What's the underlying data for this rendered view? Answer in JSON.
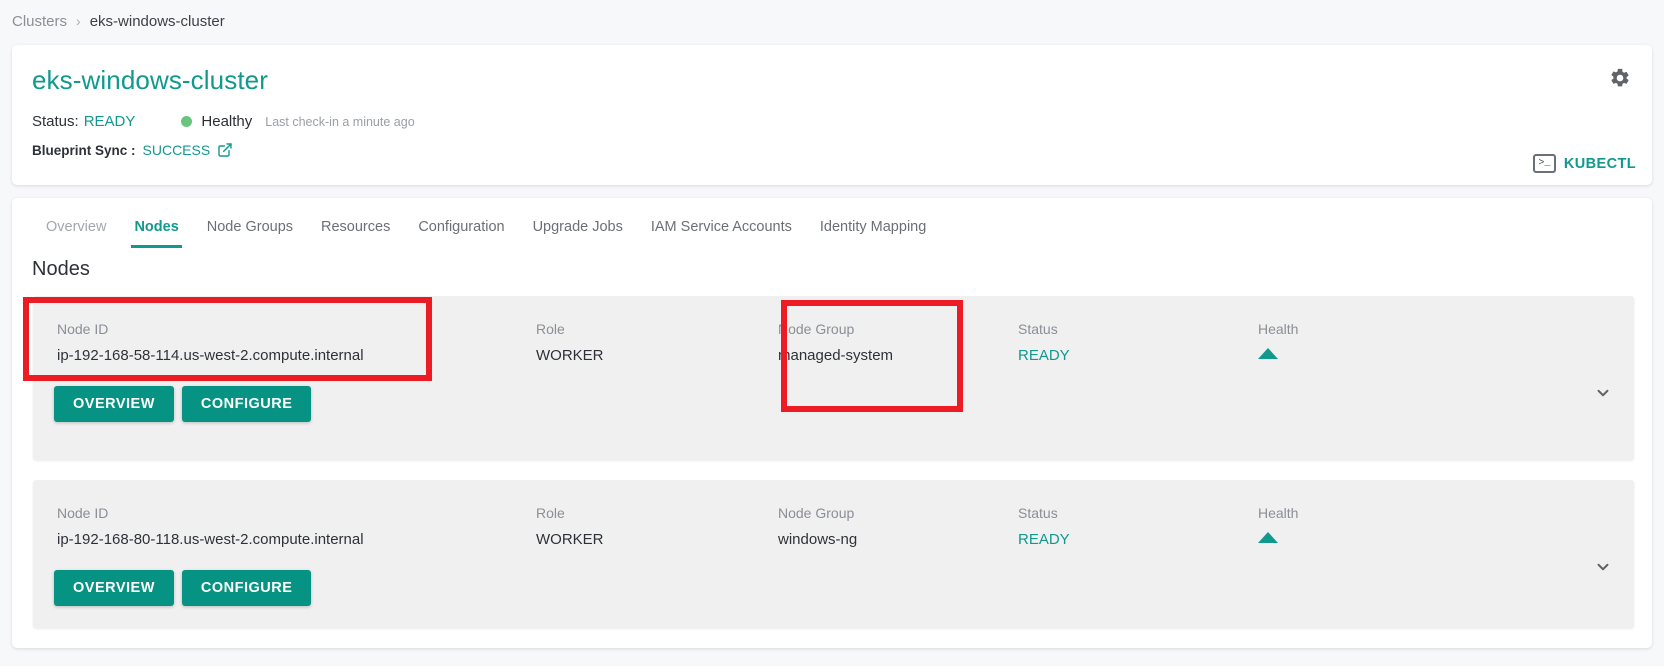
{
  "breadcrumb": {
    "parent": "Clusters",
    "separator": "›",
    "current": "eks-windows-cluster"
  },
  "summary": {
    "title": "eks-windows-cluster",
    "status_label": "Status:",
    "status_value": "READY",
    "health_text": "Healthy",
    "health_dot_color": "#6ac47e",
    "checkin_text": "Last check-in a minute ago",
    "blueprint_label": "Blueprint Sync :",
    "blueprint_value": "SUCCESS",
    "external_link_icon": "external-link-icon",
    "gear_icon": "gear-icon",
    "kubectl_label": "KUBECTL",
    "kubectl_icon": "terminal-icon",
    "terminal_glyph": ">_"
  },
  "tabs": [
    {
      "label": "Overview",
      "active": false
    },
    {
      "label": "Nodes",
      "active": true
    },
    {
      "label": "Node Groups",
      "active": false
    },
    {
      "label": "Resources",
      "active": false
    },
    {
      "label": "Configuration",
      "active": false
    },
    {
      "label": "Upgrade Jobs",
      "active": false
    },
    {
      "label": "IAM Service Accounts",
      "active": false
    },
    {
      "label": "Identity Mapping",
      "active": false
    }
  ],
  "section": {
    "title": "Nodes"
  },
  "columns": {
    "node_id": "Node ID",
    "role": "Role",
    "node_group": "Node Group",
    "status": "Status",
    "health": "Health"
  },
  "nodes": [
    {
      "node_id": "ip-192-168-58-114.us-west-2.compute.internal",
      "role": "WORKER",
      "node_group": "managed-system",
      "status": "READY",
      "health_icon": "triangle-up-icon",
      "expand_icon": "chevron-down-icon",
      "overview_label": "OVERVIEW",
      "configure_label": "CONFIGURE"
    },
    {
      "node_id": "ip-192-168-80-118.us-west-2.compute.internal",
      "role": "WORKER",
      "node_group": "windows-ng",
      "status": "READY",
      "health_icon": "triangle-up-icon",
      "expand_icon": "chevron-down-icon",
      "overview_label": "OVERVIEW",
      "configure_label": "CONFIGURE"
    }
  ],
  "annotations": [
    {
      "name": "node-id-highlight",
      "color": "#ed1c24"
    },
    {
      "name": "node-group-highlight",
      "color": "#ed1c24"
    }
  ],
  "colors": {
    "accent_teal": "#11998e",
    "button_teal": "#079383",
    "annotation_red": "#ed1c24",
    "row_bg": "#f0f0f0",
    "page_bg": "#f7f8fa"
  }
}
